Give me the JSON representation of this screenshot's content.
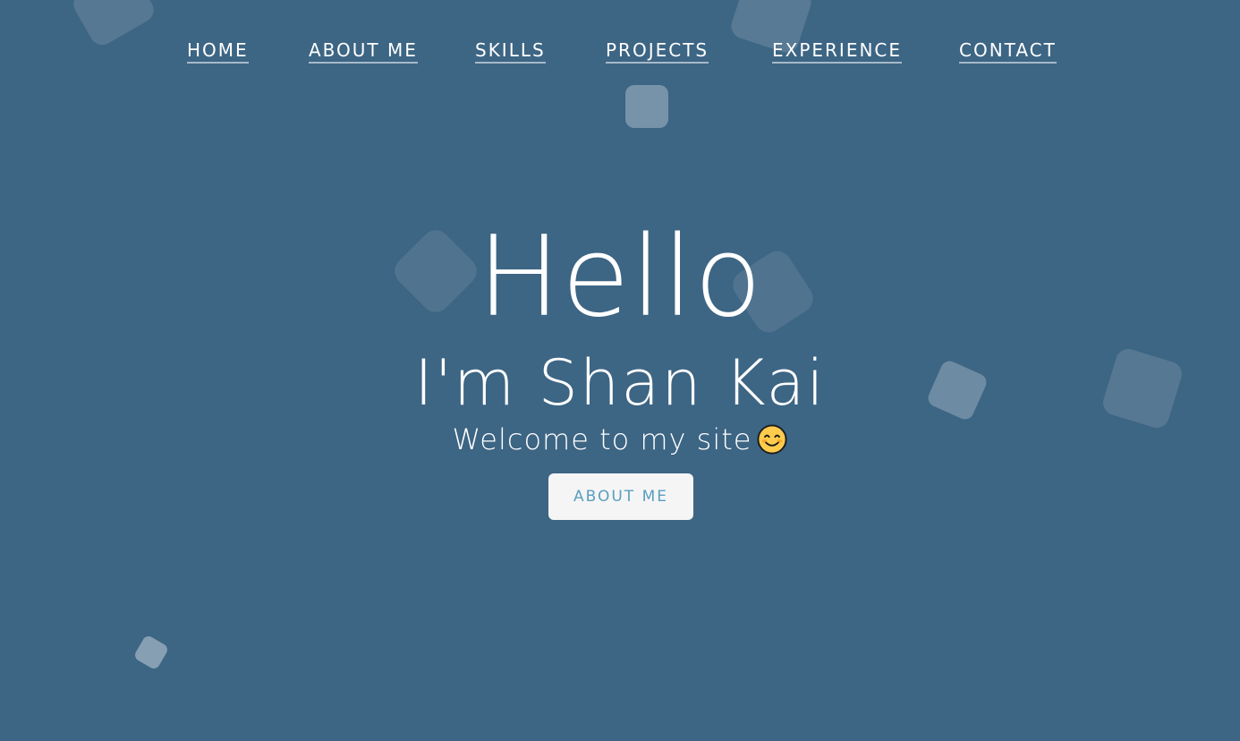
{
  "nav": {
    "items": [
      {
        "label": "HOME"
      },
      {
        "label": "ABOUT ME"
      },
      {
        "label": "SKILLS"
      },
      {
        "label": "PROJECTS"
      },
      {
        "label": "EXPERIENCE"
      },
      {
        "label": "CONTACT"
      }
    ]
  },
  "hero": {
    "title": "Hello",
    "subtitle": "I'm Shan Kai",
    "welcome": "Welcome to my site",
    "welcome_icon": "smiling-face-icon",
    "cta_label": "ABOUT ME"
  },
  "colors": {
    "background": "#3d6584",
    "text": "#ffffff",
    "button_bg": "#f5f5f5",
    "button_text": "#5a9ec0"
  }
}
